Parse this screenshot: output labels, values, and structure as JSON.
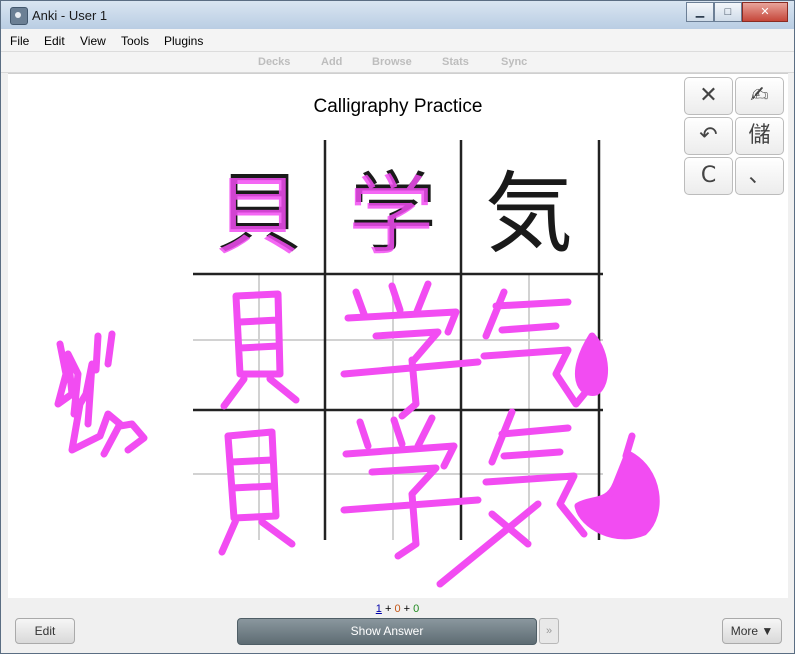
{
  "window": {
    "title": "Anki - User 1",
    "minimize": "▁",
    "maximize": "□",
    "close": "✕"
  },
  "menu": [
    "File",
    "Edit",
    "View",
    "Tools",
    "Plugins"
  ],
  "toolbar": [
    "Decks",
    "Add",
    "Browse",
    "Stats",
    "Sync"
  ],
  "card": {
    "title": "Calligraphy Practice",
    "reference_chars": [
      "貝",
      "学",
      "気"
    ],
    "ink_color": "#f24cf2"
  },
  "palette": {
    "clear": "✕",
    "pen": "✍",
    "undo": "↶",
    "kanji": "儲",
    "reset": "C",
    "stroke": "、"
  },
  "footer": {
    "new_count": "1",
    "plus1": "+",
    "learn_count": "0",
    "plus2": "+",
    "review_count": "0",
    "edit_label": "Edit",
    "show_answer_label": "Show Answer",
    "skip_label": "»",
    "more_label": "More ▼"
  }
}
